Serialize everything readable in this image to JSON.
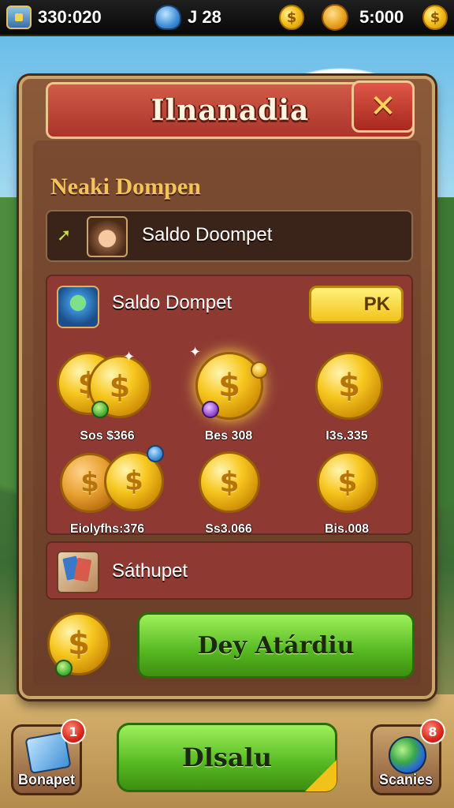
{
  "topbar": {
    "currency_1": "330:020",
    "currency_2": "J 28",
    "currency_3": "5:000",
    "coin_glyph": "$"
  },
  "dialog": {
    "title": "Ilnanadia",
    "close_glyph": "✕",
    "section_title": "Neaki Dompen",
    "balance_row_label": "Saldo Doompet",
    "coins_header_label": "Saldo Dompet",
    "pk_button": "PK",
    "coin_packs": [
      {
        "label": "Sos $366"
      },
      {
        "label": "Bes 308"
      },
      {
        "label": "I3s.335"
      },
      {
        "label": "Eiolyfhs:376"
      },
      {
        "label": "Ss3.066"
      },
      {
        "label": "Bis.008"
      }
    ],
    "cards_row_label": "Sáthupet",
    "primary_button": "Dey Atárdiu"
  },
  "bottom_nav": {
    "left_label": "Bonapet",
    "left_badge": "1",
    "center_label": "Dlsalu",
    "right_label": "Scanies",
    "right_badge": "8"
  },
  "colors": {
    "accent_green": "#55b820",
    "gold": "#f5c21c",
    "title_red": "#a9352a"
  },
  "icons": [
    "chest-icon",
    "coin-icon",
    "bird-icon",
    "bag-icon",
    "close-icon",
    "arrow-icon",
    "avatar-icon",
    "hero-icon",
    "cards-icon",
    "wallet-icon",
    "globe-icon"
  ]
}
